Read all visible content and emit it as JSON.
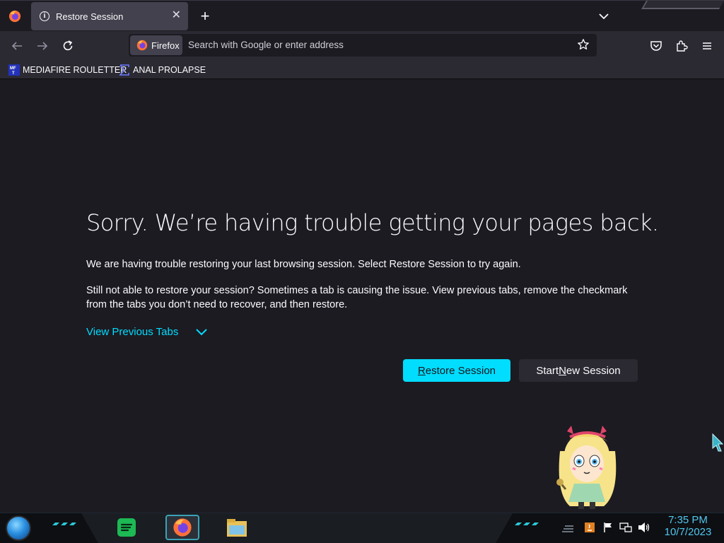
{
  "tabbar": {
    "tab_title": "Restore Session",
    "new_tab_label": "+"
  },
  "navbar": {
    "identity_label": "Firefox",
    "url_placeholder": "Search with Google or enter address"
  },
  "bookmarks": [
    {
      "label": "MEDIAFIRE ROULETTER",
      "icon": "mediafire-roulette-icon"
    },
    {
      "label": "ANAL PROLAPSE",
      "icon": "sigma-icon"
    }
  ],
  "content": {
    "heading": "Sorry. We’re having trouble getting your pages back.",
    "paragraph1": "We are having trouble restoring your last browsing session. Select Restore Session to try again.",
    "paragraph2": "Still not able to restore your session? Sometimes a tab is causing the issue. View previous tabs, remove the checkmark from the tabs you don’t need to recover, and then restore.",
    "view_previous": "View Previous Tabs",
    "restore_button": {
      "accel": "R",
      "rest": "estore Session"
    },
    "new_session_button": {
      "before": "Start ",
      "accel": "N",
      "after": "ew Session"
    }
  },
  "taskbar": {
    "apps": [
      "spotify-like-app-icon",
      "firefox-icon",
      "file-explorer-icon"
    ],
    "time": "7:35 PM",
    "date": "10/7/2023"
  },
  "colors": {
    "accent": "#00ddff",
    "page_bg": "#1c1b22",
    "toolbar_bg": "#2b2a33",
    "tab_selected": "#42414d"
  }
}
